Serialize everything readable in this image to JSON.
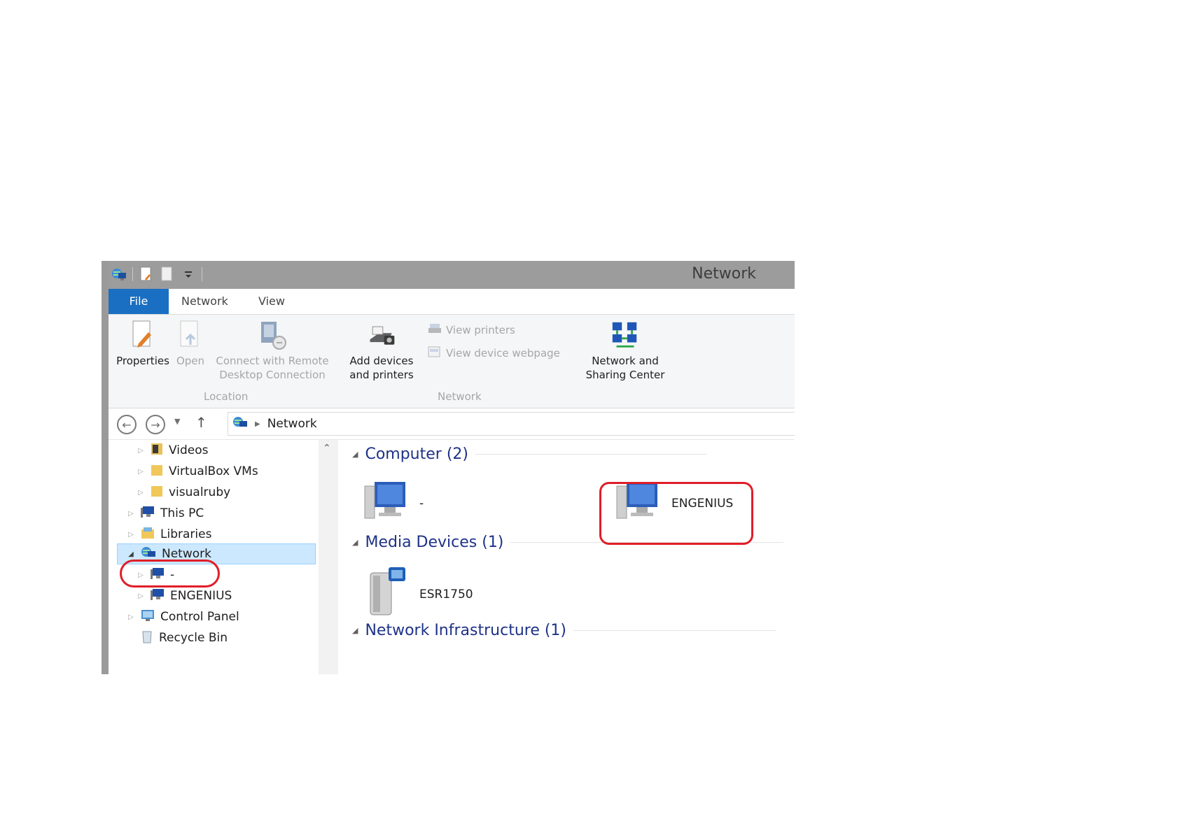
{
  "window": {
    "title": "Network"
  },
  "tabs": {
    "file": "File",
    "network": "Network",
    "view": "View"
  },
  "ribbon": {
    "properties": "Properties",
    "open": "Open",
    "connect_remote_line1": "Connect with Remote",
    "connect_remote_line2": "Desktop Connection",
    "add_devices_line1": "Add devices",
    "add_devices_line2": "and printers",
    "view_printers": "View printers",
    "view_device_webpage": "View device webpage",
    "network_sharing_line1": "Network and",
    "network_sharing_line2": "Sharing Center",
    "group_location": "Location",
    "group_network": "Network"
  },
  "address": {
    "crumb": "Network"
  },
  "tree": {
    "items": [
      {
        "label": "Videos"
      },
      {
        "label": "VirtualBox VMs"
      },
      {
        "label": "visualruby"
      },
      {
        "label": "This PC"
      },
      {
        "label": "Libraries"
      },
      {
        "label": "Network"
      },
      {
        "label": "-"
      },
      {
        "label": "ENGENIUS"
      },
      {
        "label": "Control Panel"
      },
      {
        "label": "Recycle Bin"
      }
    ]
  },
  "content": {
    "groups": {
      "computer": "Computer (2)",
      "media": "Media Devices (1)",
      "infrastructure": "Network Infrastructure (1)"
    },
    "items": {
      "computer1": "-",
      "computer2": "ENGENIUS",
      "media1": "ESR1750"
    }
  },
  "colors": {
    "file_tab": "#1b6fc2",
    "highlight": "#e01e28",
    "selection": "#cce8ff",
    "group_header": "#1e3287"
  }
}
